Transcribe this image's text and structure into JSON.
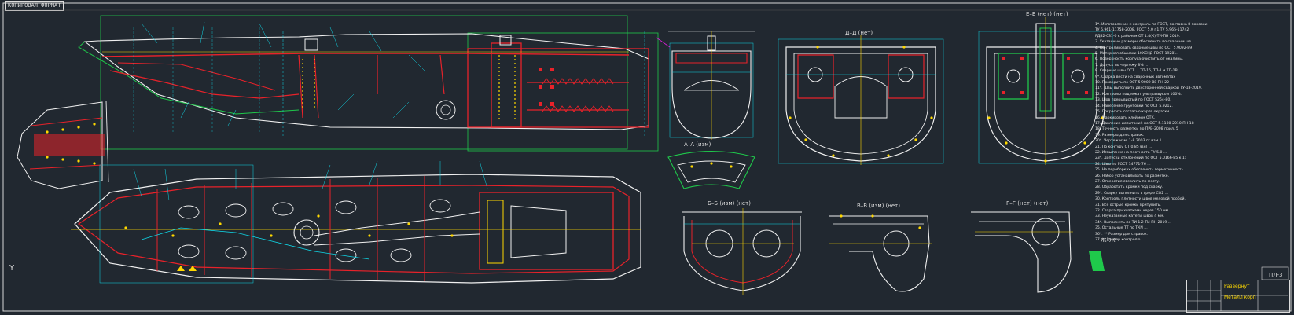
{
  "sheet": {
    "stamp_label": "КОПИРОВАЛ   ФОРМАТ",
    "sheet_number": "ПЛ-3",
    "title_block": {
      "title": "Развернут",
      "subtitle": "Металл корп"
    },
    "ucs_label": "Y"
  },
  "colors": {
    "background": "#212830",
    "red": "#e8222a",
    "white": "#f0f0f0",
    "cyan": "#10d8e8",
    "yellow": "#ffd800",
    "green": "#1fc94b",
    "magenta": "#d91fd9"
  },
  "views": [
    {
      "id": "view-a-a",
      "label": "А–А (изм)"
    },
    {
      "id": "view-b-b",
      "label": "Б–Б (изм) (нет)"
    },
    {
      "id": "view-v-v",
      "label": "В–В (изм) (нет)"
    },
    {
      "id": "view-g-g",
      "label": "Г–Г (нет) (нет)"
    },
    {
      "id": "view-d-d",
      "label": "Д–Д (нет)"
    },
    {
      "id": "view-e-e",
      "label": "Е–Е (нет) (нет)"
    },
    {
      "id": "view-j-j",
      "label": "Ж–Ж"
    }
  ],
  "notes": [
    "1*. Изготовление и контроль по ГОСТ, поставка 8 поковки",
    "ТУ 5.961-11758-2008, ГОСТ 5.0 п1.ТУ 5.965-11742",
    "РДВ2-031-0 к рабочем ОТ 1.4(К)-ТИ-ПН 2019.",
    "3. Указанные размеры обеспечить по сварным шв",
    "4. Контролировать сварные швы по ОСТ 5.9092-89",
    "5. Материал обшивки 10ХСНД ГОСТ 19281.",
    "6. Поверхность корпуса очистить от окалины.",
    "7. Допуск по чертежу 8% ...",
    "8. Сварные швы ОСТ ... ТП-15, ТП-1 и ТП-1В.",
    "9*. Сварка вести на сварочных автоматах",
    "10. Проверить по ОСТ 5.9009-88 ПН-22",
    "11*. Швы выполнить двусторонней сваркой ТУ-18-2019.",
    "12. Контролю подлежат ультразвуком 100%.",
    "13. Шов прерывистый по ГОСТ 5264-80.",
    "14. Нанесение грунтовки по ОСТ 5.9212.",
    "15. Покрасить согласно карте окраски.",
    "16. Маркировать клеймом ОТК.",
    "17. Давление испытаний по ОСТ 5.1180-2010 ПН-18",
    "18. Точность разметки по ПРВ-2008 прил. 5",
    "19. Размеры для справок.",
    "20*. Чертеж изм. 1-8 2003 гг изм 1.",
    "21. По контуру ОТ 0.85 (вн) ...",
    "22. Испытание на плотность ТУ 5.0 ...",
    "23*. Допуски отклонений по ОСТ 5.0166-85 к 1;",
    "24. Швы по ГОСТ 14771-76 ...",
    "25. На переборках обеспечить герметичность.",
    "26. Набор устанавливать по разметке.",
    "27. Отверстия сверлить по месту.",
    "28. Обработать кромки под сварку.",
    "29*. Сварку выполнить в среде CO2 ...",
    "30. Контроль плотности швов меловой пробой.",
    "31. Все острые кромки притупить.",
    "32. Сварка прихватками через 150 мм.",
    "33. Неуказанные катеты швов 4 мм.",
    "34*. Выполнить по ТИ 1.2-ТИ-ПН 2019 ...",
    "35. Остальные ТТ по ТКИ ...",
    "36*. ** Размер для справок.",
    "37. ** Размер контролю."
  ]
}
